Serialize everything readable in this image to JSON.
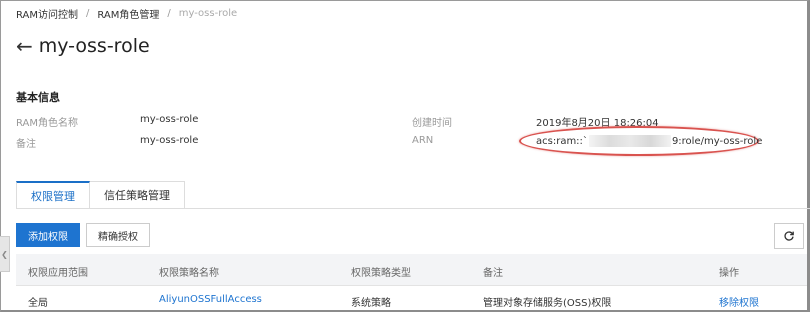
{
  "breadcrumb": {
    "items": [
      "RAM访问控制",
      "RAM角色管理"
    ],
    "separator": "/",
    "current": "my-oss-role"
  },
  "header": {
    "back_icon": "left-arrow-icon",
    "title": "my-oss-role"
  },
  "basic_info": {
    "title": "基本信息",
    "role_name_label": "RAM角色名称",
    "role_name_value": "my-oss-role",
    "note_label": "备注",
    "note_value": "my-oss-role",
    "created_label": "创建时间",
    "created_value": "2019年8月20日 18:26:04",
    "arn_label": "ARN",
    "arn_prefix": "acs:ram::`",
    "arn_suffix": "9:role/my-oss-role",
    "highlight_color": "#d9534f"
  },
  "tabs": [
    {
      "label": "权限管理",
      "active": true
    },
    {
      "label": "信任策略管理",
      "active": false
    }
  ],
  "toolbar": {
    "add_label": "添加权限",
    "precise_label": "精确授权",
    "refresh_icon": "refresh-icon"
  },
  "table": {
    "columns": [
      "权限应用范围",
      "权限策略名称",
      "权限策略类型",
      "备注",
      "操作"
    ],
    "rows": [
      {
        "scope": "全局",
        "policy_name": "AliyunOSSFullAccess",
        "policy_type": "系统策略",
        "note": "管理对象存储服务(OSS)权限",
        "action": "移除权限"
      }
    ]
  },
  "colors": {
    "primary": "#1e74d0",
    "link": "#1e74d0",
    "header_bg": "#f3f4f6"
  }
}
